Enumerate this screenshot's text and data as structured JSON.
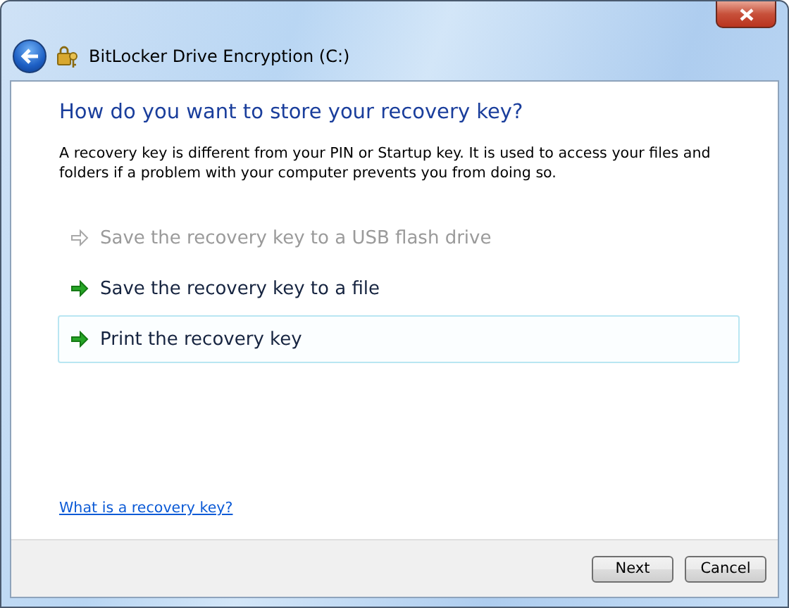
{
  "window": {
    "title": "BitLocker Drive Encryption (C:)"
  },
  "heading": "How do you want to store your recovery key?",
  "description": "A recovery key is different from your PIN or Startup key. It is used to access your files and folders if a problem with your computer prevents you from doing so.",
  "options": [
    {
      "label": "Save the recovery key to a USB flash drive",
      "disabled": true,
      "selected": false
    },
    {
      "label": "Save the recovery key to a file",
      "disabled": false,
      "selected": false
    },
    {
      "label": "Print the recovery key",
      "disabled": false,
      "selected": true
    }
  ],
  "help_link": "What is a recovery key?",
  "buttons": [
    "Next",
    "Cancel"
  ]
}
